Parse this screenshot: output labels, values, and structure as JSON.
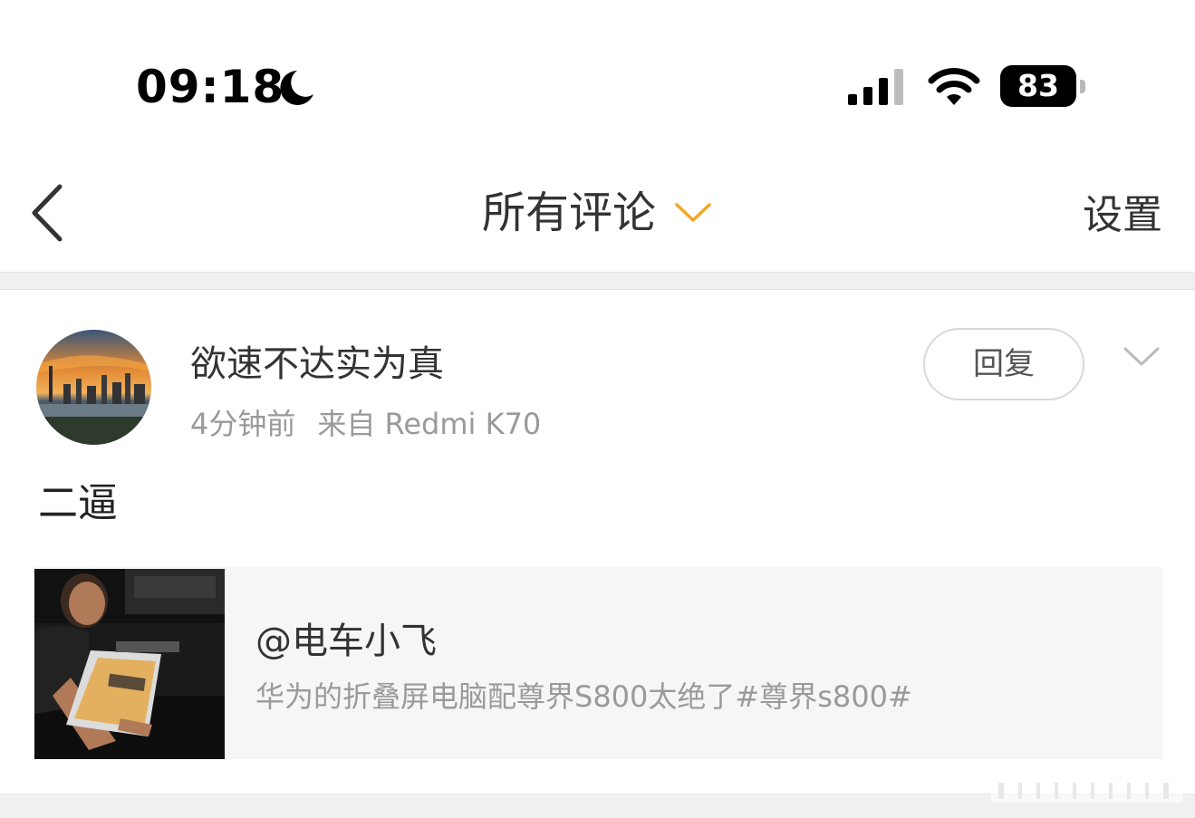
{
  "status_bar": {
    "time": "09:18",
    "battery": "83",
    "icons": [
      "moon-icon",
      "signal-icon",
      "wifi-icon",
      "battery-icon"
    ]
  },
  "nav": {
    "title": "所有评论",
    "settings_label": "设置",
    "accent_color": "#f5a623",
    "icons": [
      "back-arrow-icon",
      "chevron-down-icon"
    ]
  },
  "comment": {
    "username": "欲速不达实为真",
    "time_ago": "4分钟前",
    "source": "来自 Redmi K70",
    "reply_label": "回复",
    "text": "二逼",
    "quoted": {
      "author": "@电车小飞",
      "text": "华为的折叠屏电脑配尊界S800太绝了#尊界s800#"
    }
  }
}
